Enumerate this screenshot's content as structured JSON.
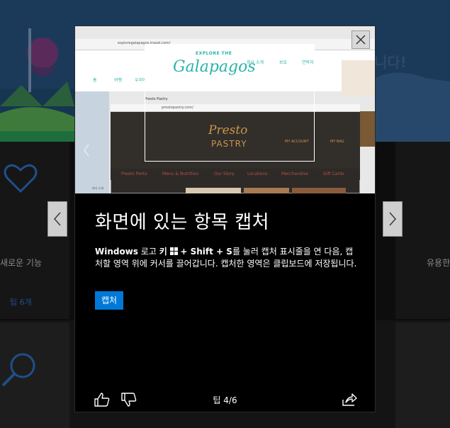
{
  "tip": {
    "title": "화면에 있는 항목 캡처",
    "desc_key1": "Windows",
    "desc_text1": " 로고 ",
    "desc_key2": "키",
    "desc_key3": "+ Shift + S",
    "desc_text2": "를 눌러 캡처 표시줄을 연 다음, 캡처할 영역 위에 커서를 끌어갑니다. 캡처한 영역은 클립보드에 저장됩니다.",
    "capture_button": "캡처",
    "counter": "팁 4/6"
  },
  "background": {
    "headline": "니다!",
    "left_label": "새로운 기능",
    "left_link": "팁 6개",
    "right_label": "유용한"
  },
  "hero": {
    "browser1_url": "exploregalapagos.travel.com/",
    "browser1_nav": [
      "홈",
      "여행",
      "우리에 관해",
      "회사 소개",
      "보호",
      "연락처"
    ],
    "logo_top": "EXPLORE THE",
    "logo_main": "Galapagos",
    "browser2_tab": "Presto Pastry",
    "browser2_url": "prestopastry.com/",
    "pastry_line1": "Presto",
    "pastry_line2": "PASTRY",
    "my_account": "MY ACCOUNT",
    "my_bag": "MY BAG",
    "pastry_nav": [
      "Presto Perks",
      "Menu & Nutrition",
      "Our Story",
      "Locations",
      "Merchandise",
      "Gift Cards"
    ],
    "side_label": "회사 소개"
  },
  "colors": {
    "accent": "#0078d7",
    "galapagos": "#2bb3a8",
    "pastry_gold": "#c9964a",
    "pastry_nav": "#b5524a"
  }
}
